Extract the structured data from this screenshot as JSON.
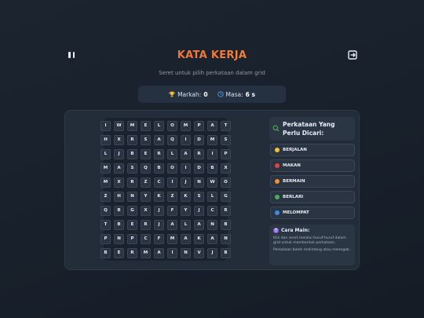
{
  "header": {
    "title": "KATA KERJA",
    "subtitle": "Seret untuk pilih perkataan dalam grid"
  },
  "stats": {
    "score_label": "Markah:",
    "score_value": "0",
    "time_label": "Masa:",
    "time_value": "6 s"
  },
  "grid": [
    [
      "I",
      "W",
      "M",
      "E",
      "L",
      "O",
      "M",
      "P",
      "A",
      "T"
    ],
    [
      "H",
      "X",
      "R",
      "S",
      "A",
      "Q",
      "I",
      "D",
      "M",
      "S"
    ],
    [
      "L",
      "J",
      "B",
      "E",
      "R",
      "L",
      "A",
      "R",
      "I",
      "P"
    ],
    [
      "M",
      "A",
      "S",
      "Q",
      "B",
      "O",
      "I",
      "D",
      "B",
      "X"
    ],
    [
      "M",
      "X",
      "R",
      "Z",
      "C",
      "I",
      "J",
      "N",
      "W",
      "O"
    ],
    [
      "Z",
      "H",
      "N",
      "Y",
      "K",
      "Z",
      "K",
      "S",
      "L",
      "G"
    ],
    [
      "Q",
      "B",
      "G",
      "X",
      "J",
      "F",
      "Y",
      "J",
      "C",
      "R"
    ],
    [
      "T",
      "B",
      "E",
      "R",
      "J",
      "A",
      "L",
      "A",
      "N",
      "B"
    ],
    [
      "P",
      "N",
      "P",
      "C",
      "F",
      "M",
      "A",
      "K",
      "A",
      "N"
    ],
    [
      "B",
      "E",
      "R",
      "M",
      "A",
      "I",
      "N",
      "V",
      "J",
      "B"
    ]
  ],
  "words_panel": {
    "title": "Perkataan Yang Perlu Dicari:",
    "words": [
      {
        "label": "BERJALAN",
        "color": "#f2c230"
      },
      {
        "label": "MAKAN",
        "color": "#e0443a"
      },
      {
        "label": "BERMAIN",
        "color": "#f0932b"
      },
      {
        "label": "BERLARI",
        "color": "#4caf50"
      },
      {
        "label": "MELOMPAT",
        "color": "#3b8fe0"
      }
    ]
  },
  "howto": {
    "title": "Cara Main:",
    "line1": "Klik dan seret melalui huruf-huruf dalam grid untuk membentuk perkataan.",
    "line2": "Perkataan boleh melintang atau menegak."
  },
  "icons": {
    "pause": "pause-icon",
    "exit": "exit-icon",
    "trophy": "trophy-icon",
    "clock": "clock-icon",
    "search": "search-icon",
    "help": "question-icon"
  }
}
